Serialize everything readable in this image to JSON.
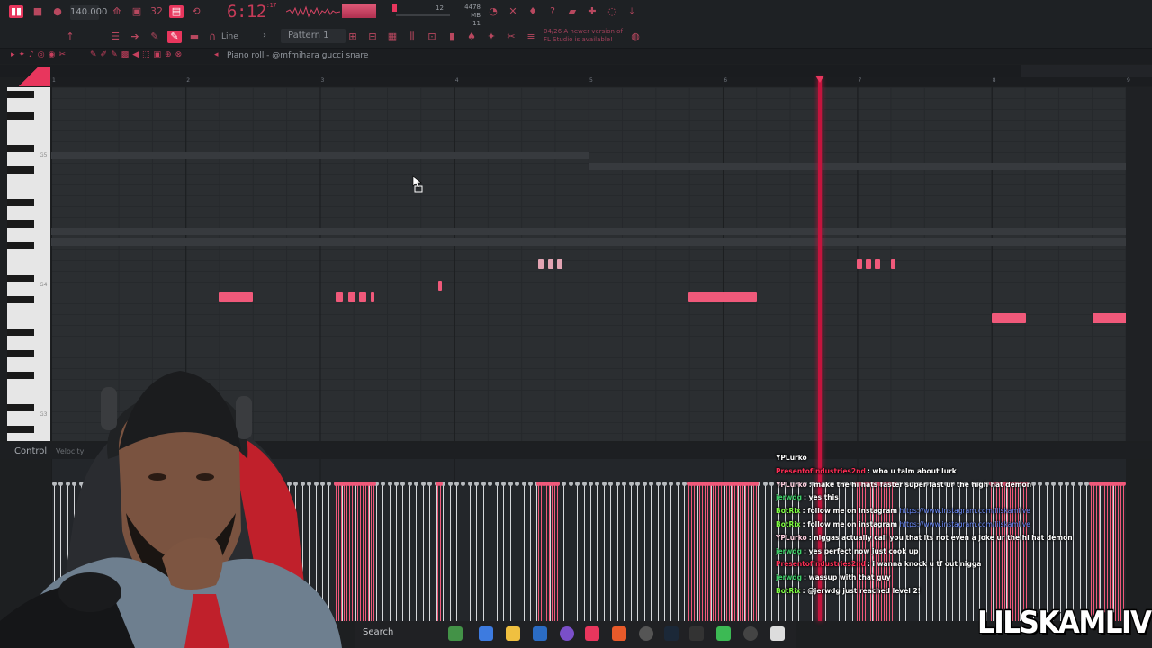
{
  "toolbar": {
    "tempo": "140.000",
    "clock": "6:12",
    "clock_sub": ":17",
    "memory_top": "4478 MB",
    "memory_bottom": "11",
    "cpu_label": "12",
    "pattern": "Pattern 1",
    "snap": "Line",
    "update_notice_date": "04/26",
    "update_notice_line1": "A newer version of",
    "update_notice_line2": "FL Studio is available!"
  },
  "piano_roll": {
    "title": "Piano roll - @mfmihara gucci snare",
    "bar_numbers": [
      "1",
      "2",
      "3",
      "4",
      "5",
      "6",
      "7",
      "8",
      "9"
    ],
    "key_labels": [
      "G5",
      "G4",
      "G3"
    ],
    "control_label": "Control",
    "control_value": "Velocity",
    "accent_color": "#f0597a",
    "playhead_color": "#c4143d"
  },
  "chat": {
    "messages": [
      {
        "user": "YPLurko",
        "user_color": "#ffffff",
        "text": ""
      },
      {
        "user": "PresentofIndustries2nd",
        "user_color": "#ff2d55",
        "text": ": who u talm about lurk"
      },
      {
        "user": "YPLurko",
        "user_color": "#ffd0e0",
        "text": ": make the hi hats faster super fast ur the high hat demon"
      },
      {
        "user": "jerwdg",
        "user_color": "#3fd16a",
        "text": ": yes this"
      },
      {
        "user": "BotRix",
        "user_color": "#7cfc3f",
        "text": ": follow me on instagram",
        "link": "https://www.instagram.com/lilskamlive"
      },
      {
        "user": "BotRix",
        "user_color": "#7cfc3f",
        "text": ": follow me on instagram",
        "link": "https://www.instagram.com/lilskamlive"
      },
      {
        "user": "YPLurko",
        "user_color": "#ffd0e0",
        "text": ": niggas actually call you that its not even a joke ur the hi hat demon"
      },
      {
        "user": "jerwdg",
        "user_color": "#3fd16a",
        "text": ": yes perfect now just cook up"
      },
      {
        "user": "PresentofIndustries2nd",
        "user_color": "#ff2d55",
        "text": ": i wanna knock u tf out nigga"
      },
      {
        "user": "jerwdg",
        "user_color": "#3fd16a",
        "text": ": wassup with that guy"
      },
      {
        "user": "BotRix",
        "user_color": "#7cfc3f",
        "text": ": @jerwdg just reached level 2!"
      }
    ]
  },
  "taskbar": {
    "search": "Search"
  },
  "watermark": "LILSKAMLIVE"
}
